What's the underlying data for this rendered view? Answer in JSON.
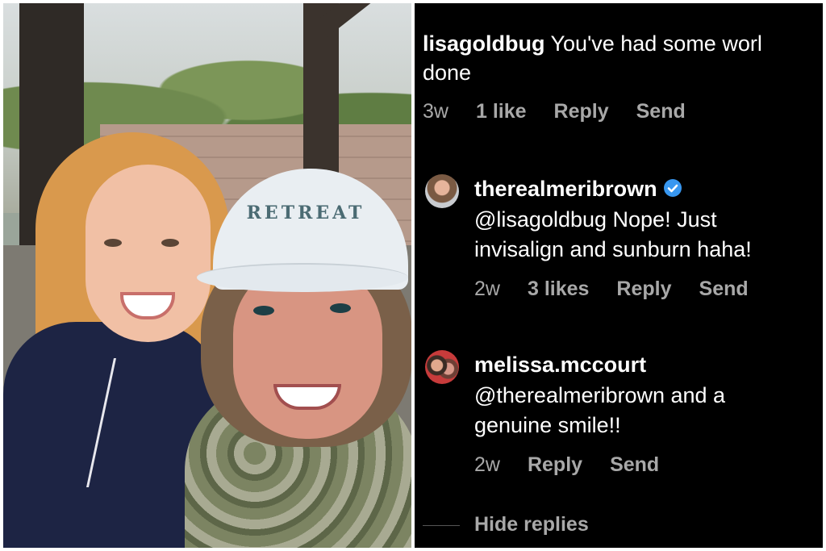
{
  "comments": [
    {
      "username": "lisagoldbug",
      "text_line1": "You've had some worl",
      "text_line2": "done",
      "time": "3w",
      "likes": "1 like",
      "reply": "Reply",
      "send": "Send"
    },
    {
      "username": "therealmeribrown",
      "verified": true,
      "text_line1": "@lisagoldbug Nope! Just",
      "text_line2": "invisalign and sunburn haha!",
      "time": "2w",
      "likes": "3 likes",
      "reply": "Reply",
      "send": "Send",
      "avatar": "woman-avatar"
    },
    {
      "username": "melissa.mccourt",
      "text_line1": "@therealmeribrown and a",
      "text_line2": "genuine smile!!",
      "time": "2w",
      "reply": "Reply",
      "send": "Send",
      "avatar": "two-women-avatar"
    }
  ],
  "hide_replies": "Hide replies",
  "colors": {
    "background": "#000000",
    "text": "#ffffff",
    "meta": "#a8a8a8",
    "verified": "#3897f0"
  },
  "photo": {
    "description_icon": "selfie-photo",
    "cap_text": "RETREAT"
  }
}
